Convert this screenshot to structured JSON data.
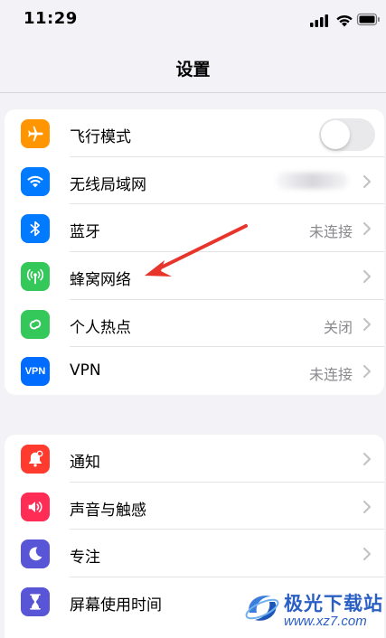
{
  "status_bar": {
    "time": "11:29"
  },
  "nav": {
    "title": "设置"
  },
  "groups": [
    {
      "rows": [
        {
          "label": "飞行模式",
          "icon": "airplane-icon",
          "color": "#ff9500",
          "toggle": false
        },
        {
          "label": "无线局域网",
          "icon": "wifi-icon",
          "color": "#007aff"
        },
        {
          "label": "蓝牙",
          "icon": "bluetooth-icon",
          "color": "#007aff",
          "value": "未连接"
        },
        {
          "label": "蜂窝网络",
          "icon": "antenna-icon",
          "color": "#34c759"
        },
        {
          "label": "个人热点",
          "icon": "link-icon",
          "color": "#34c759",
          "value": "关闭"
        },
        {
          "label": "VPN",
          "icon": "vpn-icon",
          "icon_text": "VPN",
          "color": "#006bff",
          "value": "未连接"
        }
      ]
    },
    {
      "rows": [
        {
          "label": "通知",
          "icon": "bell-icon",
          "color": "#ff3b30"
        },
        {
          "label": "声音与触感",
          "icon": "speaker-icon",
          "color": "#ff2d55"
        },
        {
          "label": "专注",
          "icon": "moon-icon",
          "color": "#5856d6"
        },
        {
          "label": "屏幕使用时间",
          "icon": "hourglass-icon",
          "color": "#5856d6"
        }
      ]
    }
  ],
  "annotation": {
    "arrow_color": "#e8352b"
  },
  "watermark": {
    "name": "极光下载站",
    "url": "www.xz7.com"
  }
}
